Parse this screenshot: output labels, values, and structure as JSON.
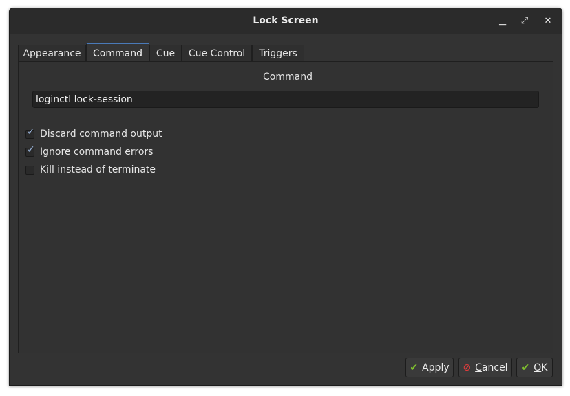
{
  "window": {
    "title": "Lock Screen"
  },
  "titlebar_buttons": {
    "minimize": "▁",
    "maximize": "⤢",
    "close": "✕"
  },
  "tabs": [
    {
      "label": "Appearance",
      "active": false
    },
    {
      "label": "Command",
      "active": true
    },
    {
      "label": "Cue",
      "active": false
    },
    {
      "label": "Cue Control",
      "active": false
    },
    {
      "label": "Triggers",
      "active": false
    }
  ],
  "command_group": {
    "title": "Command",
    "input_value": "loginctl lock-session"
  },
  "options": [
    {
      "label": "Discard command output",
      "checked": true
    },
    {
      "label": "Ignore command errors",
      "checked": true
    },
    {
      "label": "Kill instead of terminate",
      "checked": false
    }
  ],
  "buttons": {
    "apply": {
      "label": "Apply",
      "icon": "checkmark-icon"
    },
    "cancel": {
      "label_first": "C",
      "label_rest": "ancel",
      "icon": "cancel-icon"
    },
    "ok": {
      "label_first": "O",
      "label_rest": "K",
      "icon": "checkmark-icon"
    }
  },
  "colors": {
    "accent": "#4a7ab8",
    "apply_icon": "#7fbf2e",
    "cancel_icon": "#e53c3c"
  }
}
